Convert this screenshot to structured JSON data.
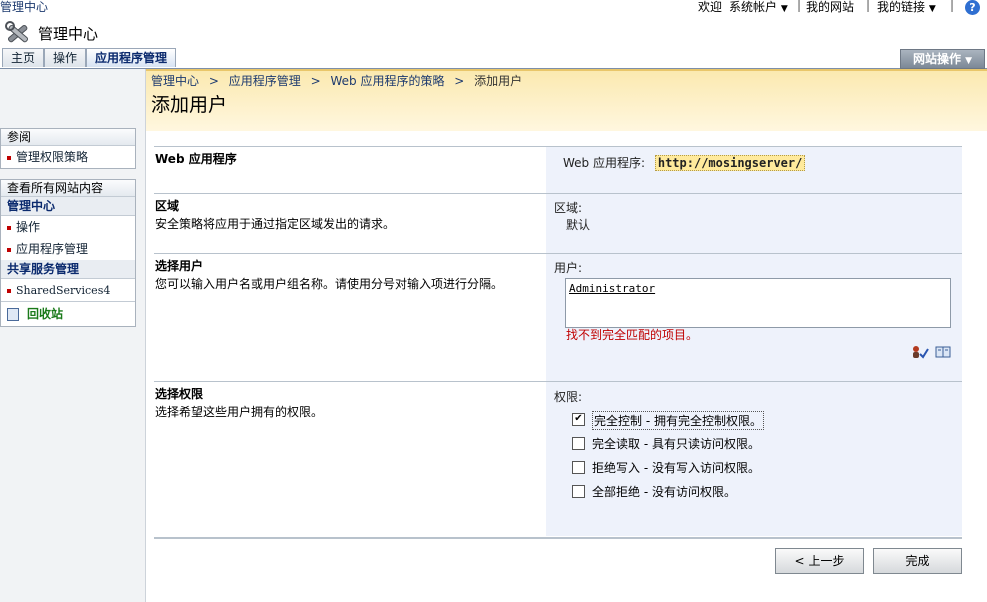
{
  "top": {
    "site_name": "管理中心",
    "welcome": "欢迎",
    "account": "系统帐户",
    "my_site": "我的网站",
    "my_links": "我的链接"
  },
  "header": {
    "center_title": "管理中心",
    "tabs": [
      {
        "label": "主页"
      },
      {
        "label": "操作"
      },
      {
        "label": "应用程序管理",
        "active": true
      }
    ],
    "site_actions": "网站操作"
  },
  "nav": {
    "see_also": "参阅",
    "manage_policy": "管理权限策略",
    "view_all": "查看所有网站内容",
    "central_admin": "管理中心",
    "operations": "操作",
    "app_management": "应用程序管理",
    "shared_services": "共享服务管理",
    "shared_services_item": "SharedServices4",
    "recycle_bin": "回收站"
  },
  "breadcrumb": {
    "items": [
      "管理中心",
      "应用程序管理",
      "Web 应用程序的策略",
      "添加用户"
    ],
    "separator": ">"
  },
  "page_title": "添加用户",
  "form": {
    "web_app": {
      "title": "Web 应用程序",
      "field_label": "Web 应用程序:",
      "url": "http://mosingserver/"
    },
    "zone": {
      "title": "区域",
      "desc": "安全策略将应用于通过指定区域发出的请求。",
      "field_label": "区域:",
      "value": "默认"
    },
    "users": {
      "title": "选择用户",
      "desc": "您可以输入用户名或用户组名称。请使用分号对输入项进行分隔。",
      "field_label": "用户:",
      "value": "Administrator",
      "error": "找不到完全匹配的项目。"
    },
    "permissions": {
      "title": "选择权限",
      "desc": "选择希望这些用户拥有的权限。",
      "field_label": "权限:",
      "options": [
        {
          "label": "完全控制 - 拥有完全控制权限。",
          "checked": true
        },
        {
          "label": "完全读取 - 具有只读访问权限。",
          "checked": false
        },
        {
          "label": "拒绝写入 - 没有写入访问权限。",
          "checked": false
        },
        {
          "label": "全部拒绝 - 没有访问权限。",
          "checked": false
        }
      ]
    }
  },
  "buttons": {
    "back": "上一步",
    "finish": "完成"
  }
}
